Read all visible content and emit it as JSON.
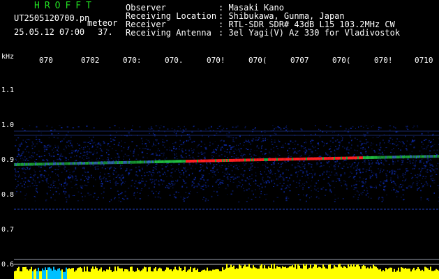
{
  "header": {
    "brand": "HROFFT",
    "file_name": "UT2505120700.pn",
    "kind": "meteor",
    "timestamp": "25.05.12 07:00",
    "count": "37.",
    "meta": [
      {
        "key": "Observer",
        "value": ": Masaki Kano"
      },
      {
        "key": "Receiving Location",
        "value": ": Shibukawa, Gunma, Japan"
      },
      {
        "key": "Receiver",
        "value": ": RTL-SDR SDR# 43dB L15 103.2MHz CW"
      },
      {
        "key": "Receiving Antenna",
        "value": ": 3el Yagi(V) Az 330 for Vladivostok"
      }
    ]
  },
  "axes": {
    "unit": "kHz",
    "y_ticks": [
      "1.1",
      "1.0",
      "0.9",
      "0.8",
      "0.7",
      "0.6"
    ],
    "x_ticks": [
      "070",
      "0702",
      "070:",
      "070.",
      "070!",
      "070(",
      "0707",
      "070(",
      "070!",
      "0710"
    ]
  },
  "colors": {
    "brand": "#22dd22",
    "band_peak": "#ff2020",
    "band_mid": "#20c040",
    "noise": "#1030c0",
    "meter": "#ffff00",
    "meter_low": "#00c0ff"
  }
}
